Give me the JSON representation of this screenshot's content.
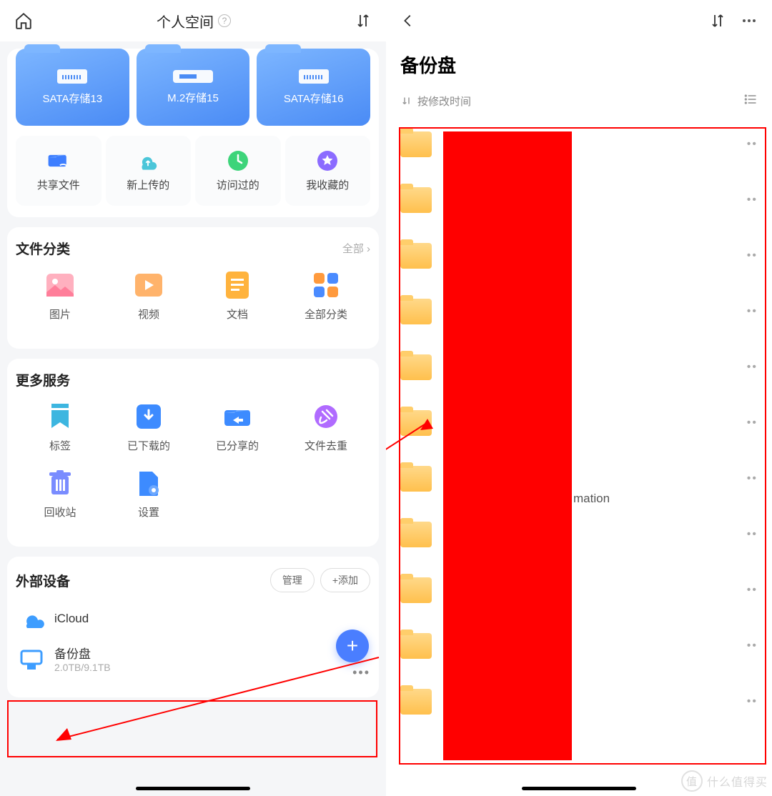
{
  "left": {
    "title": "个人空间",
    "storages": [
      {
        "label": "SATA存储13",
        "type": "hdd"
      },
      {
        "label": "M.2存储15",
        "type": "ssd"
      },
      {
        "label": "SATA存储16",
        "type": "hdd"
      }
    ],
    "quick": {
      "shared": "共享文件",
      "uploaded": "新上传的",
      "visited": "访问过的",
      "favorite": "我收藏的"
    },
    "fileCategory": {
      "title": "文件分类",
      "all": "全部",
      "items": {
        "image": "图片",
        "video": "视频",
        "doc": "文档",
        "allcat": "全部分类"
      }
    },
    "moreServices": {
      "title": "更多服务",
      "items": {
        "tag": "标签",
        "download": "已下载的",
        "shared": "已分享的",
        "dedupe": "文件去重",
        "trash": "回收站",
        "settings": "设置"
      }
    },
    "external": {
      "title": "外部设备",
      "manage": "管理",
      "add": "+添加",
      "icloud": "iCloud",
      "backup": {
        "name": "备份盘",
        "size": "2.0TB/9.1TB"
      }
    }
  },
  "right": {
    "title": "备份盘",
    "sort": "按修改时间",
    "visibleText": "mation",
    "folderCount": 11
  },
  "watermark": {
    "badge": "值",
    "text": "什么值得买"
  }
}
